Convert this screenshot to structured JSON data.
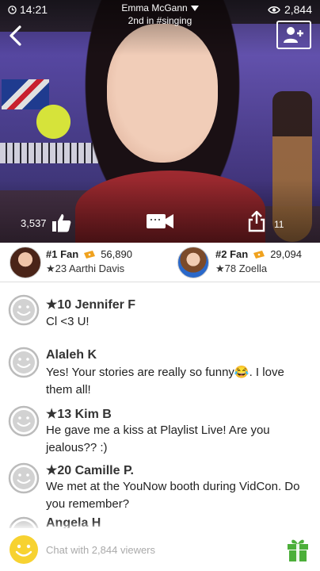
{
  "status": {
    "time": "14:21",
    "viewers": "2,844"
  },
  "channel": {
    "name": "Emma McGann",
    "rank": "2nd in #singing"
  },
  "video": {
    "likes": "3,537",
    "shares": "11"
  },
  "top_fans": [
    {
      "rank_label": "#1 Fan",
      "bars": "56,890",
      "user": "★23 Aarthi Davis"
    },
    {
      "rank_label": "#2 Fan",
      "bars": "29,094",
      "user": "★78 Zoella"
    }
  ],
  "messages": [
    {
      "name": "★10 Jennifer F",
      "text": "Cl <3 U!"
    },
    {
      "name": "Alaleh K",
      "text": "Yes! Your stories are really so funny😂. I love them all!"
    },
    {
      "name": "★13 Kim B",
      "text": "He gave me a kiss at Playlist Live! Are you jealous?? :)"
    },
    {
      "name": "★20 Camille P.",
      "text": "We met at the YouNow booth during VidCon. Do you remember?"
    },
    {
      "name": "Angela H",
      "text": ""
    }
  ],
  "chat_input": {
    "placeholder": "Chat with 2,844 viewers"
  },
  "colors": {
    "emoji_yellow": "#f7d231",
    "gift_green": "#4caf3a",
    "ticket_orange": "#f0a21e"
  },
  "icons": [
    "clock-icon",
    "eye-icon",
    "back-icon",
    "add-user-icon",
    "thumbs-up-icon",
    "video-camera-icon",
    "share-icon",
    "ticket-icon",
    "smiley-face-icon",
    "emoji-icon",
    "gift-icon"
  ]
}
